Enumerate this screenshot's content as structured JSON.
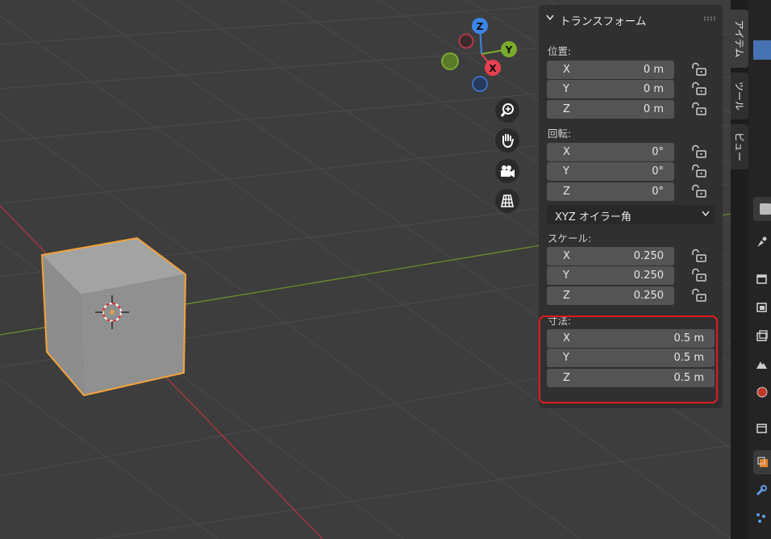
{
  "navigation_gizmo": {
    "z_label": "Z",
    "y_label": "Y",
    "x_label": "X"
  },
  "viewport_tools": [
    {
      "icon": "zoom-icon"
    },
    {
      "icon": "hand-pan-icon"
    },
    {
      "icon": "camera-icon"
    },
    {
      "icon": "grid-ortho-icon"
    }
  ],
  "panel": {
    "title": "トランスフォーム",
    "location": {
      "label": "位置:",
      "rows": [
        {
          "axis": "X",
          "value": "0 m"
        },
        {
          "axis": "Y",
          "value": "0 m"
        },
        {
          "axis": "Z",
          "value": "0 m"
        }
      ]
    },
    "rotation": {
      "label": "回転:",
      "rows": [
        {
          "axis": "X",
          "value": "0°"
        },
        {
          "axis": "Y",
          "value": "0°"
        },
        {
          "axis": "Z",
          "value": "0°"
        }
      ]
    },
    "rotation_mode": "XYZ オイラー角",
    "scale": {
      "label": "スケール:",
      "rows": [
        {
          "axis": "X",
          "value": "0.250"
        },
        {
          "axis": "Y",
          "value": "0.250"
        },
        {
          "axis": "Z",
          "value": "0.250"
        }
      ]
    },
    "dimensions": {
      "label": "寸法:",
      "rows": [
        {
          "axis": "X",
          "value": "0.5 m"
        },
        {
          "axis": "Y",
          "value": "0.5 m"
        },
        {
          "axis": "Z",
          "value": "0.5 m"
        }
      ]
    }
  },
  "sidebar_tabs": [
    {
      "label": "アイテム",
      "active": true
    },
    {
      "label": "ツール",
      "active": false
    },
    {
      "label": "ビュー",
      "active": false
    }
  ],
  "colors": {
    "viewport_bg": "#3d3d3d",
    "selection_outline": "#f5a23a",
    "highlight_box": "#e01b1b",
    "axis_x": "#e8404f",
    "axis_y": "#7bab2d",
    "axis_z": "#3c86e8"
  }
}
